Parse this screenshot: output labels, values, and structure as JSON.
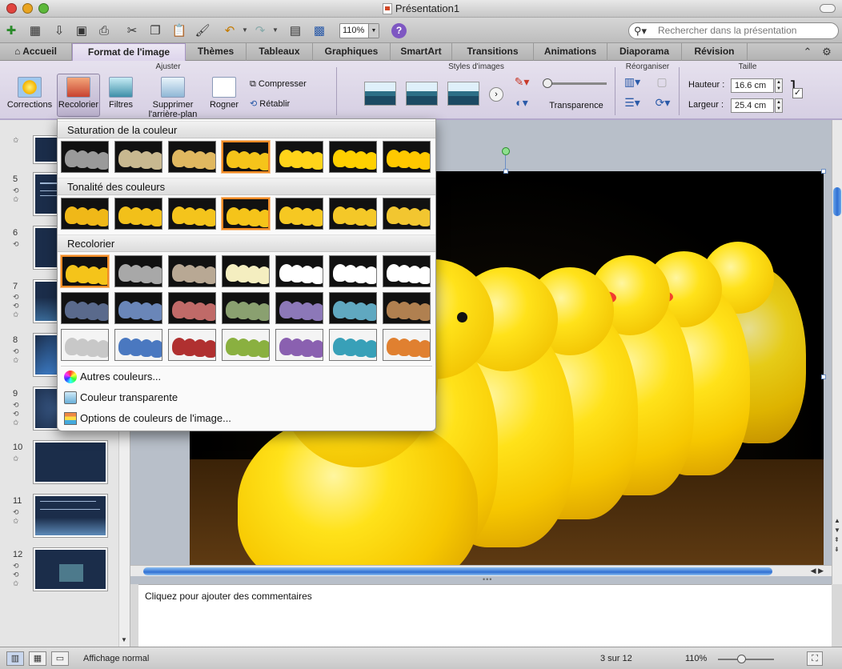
{
  "window": {
    "title": "Présentation1"
  },
  "toolbar": {
    "zoom_value": "110%",
    "search_placeholder": "Rechercher dans la présentation",
    "help_label": "?"
  },
  "tabs": [
    {
      "label": "Accueil",
      "active": false
    },
    {
      "label": "Format de l'image",
      "active": true
    },
    {
      "label": "Thèmes",
      "active": false
    },
    {
      "label": "Tableaux",
      "active": false
    },
    {
      "label": "Graphiques",
      "active": false
    },
    {
      "label": "SmartArt",
      "active": false
    },
    {
      "label": "Transitions",
      "active": false
    },
    {
      "label": "Animations",
      "active": false
    },
    {
      "label": "Diaporama",
      "active": false
    },
    {
      "label": "Révision",
      "active": false
    }
  ],
  "ribbon": {
    "groups": {
      "ajuster": "Ajuster",
      "styles": "Styles d'images",
      "reorganiser": "Réorganiser",
      "taille": "Taille"
    },
    "buttons": {
      "corrections": "Corrections",
      "recolorier": "Recolorier",
      "filtres": "Filtres",
      "supprimer": "Supprimer",
      "supprimer2": "l'arrière-plan",
      "rogner": "Rogner",
      "compresser": "Compresser",
      "retablir": "Rétablir",
      "transparence": "Transparence"
    },
    "size": {
      "height_label": "Hauteur :",
      "height_value": "16.6 cm",
      "width_label": "Largeur :",
      "width_value": "25.4 cm"
    }
  },
  "slides": [
    {
      "number": "5"
    },
    {
      "number": "6"
    },
    {
      "number": "7"
    },
    {
      "number": "8"
    },
    {
      "number": "9"
    },
    {
      "number": "10"
    },
    {
      "number": "11"
    },
    {
      "number": "12"
    }
  ],
  "recolor_menu": {
    "section_saturation": "Saturation de la couleur",
    "section_tonalite": "Tonalité des couleurs",
    "section_recolorier": "Recolorier",
    "item_other_colors": "Autres couleurs...",
    "item_transparent": "Couleur transparente",
    "item_options": "Options de couleurs de l'image...",
    "saturation_colors": [
      "#9a9a9a",
      "#c8b890",
      "#e0b860",
      "#f5c41a",
      "#ffd41a",
      "#ffd000",
      "#ffc800"
    ],
    "tonalite_colors": [
      "#f0b818",
      "#f2c01a",
      "#f4c41c",
      "#f5c41a",
      "#f6c822",
      "#f4c828",
      "#f2c630"
    ],
    "recolor_row1": [
      "#f5c41a",
      "#a8a8a8",
      "#b8a894",
      "#f4eec0",
      "#ffffff",
      "#ffffff",
      "#ffffff"
    ],
    "recolor_row2": [
      "#5a6a8c",
      "#6a86b8",
      "#c06a68",
      "#8aa070",
      "#8c78b8",
      "#60a8c0",
      "#b08050"
    ],
    "recolor_row3": [
      "#c8c8c8",
      "#4a78c0",
      "#b03030",
      "#8ab040",
      "#8a60b0",
      "#38a0b8",
      "#e08030"
    ]
  },
  "notes": {
    "placeholder": "Cliquez pour ajouter des commentaires"
  },
  "status": {
    "view": "Affichage normal",
    "slide_pos": "3 sur 12",
    "zoom": "110%"
  },
  "colors": {
    "accent": "#f08a24",
    "ribbon": "#ddd4ec",
    "scroll": "#2f6fd3"
  }
}
